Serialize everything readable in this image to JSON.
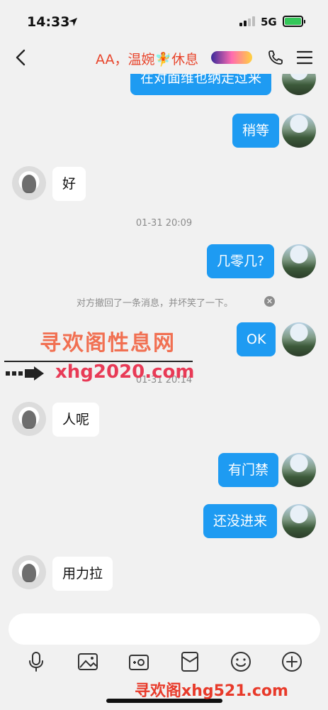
{
  "status_bar": {
    "time": "14:33",
    "network": "5G"
  },
  "nav": {
    "title": "AA，温婉🧚休息"
  },
  "messages": [
    {
      "side": "self",
      "text": "在对面维也纳走过来"
    },
    {
      "side": "self",
      "text": "稍等"
    },
    {
      "side": "other",
      "text": "好"
    },
    {
      "type": "timestamp",
      "text": "01-31 20:09"
    },
    {
      "side": "self",
      "text": "几零几?"
    },
    {
      "type": "recall",
      "text": "对方撤回了一条消息，并坏笑了一下。"
    },
    {
      "side": "self",
      "text": "OK"
    },
    {
      "type": "timestamp",
      "text": "01-31 20:14"
    },
    {
      "side": "other",
      "text": "人呢"
    },
    {
      "side": "self",
      "text": "有门禁"
    },
    {
      "side": "self",
      "text": "还没进来"
    },
    {
      "side": "other",
      "text": "用力拉"
    }
  ],
  "watermark": {
    "line1": "寻欢阁性息网",
    "line2": "xhg2020.com",
    "line3": "寻欢阁xhg521.com"
  },
  "input": {
    "placeholder": ""
  },
  "toolbar": [
    "mic-icon",
    "image-icon",
    "camera-icon",
    "red-packet-icon",
    "emoji-icon",
    "plus-icon"
  ]
}
